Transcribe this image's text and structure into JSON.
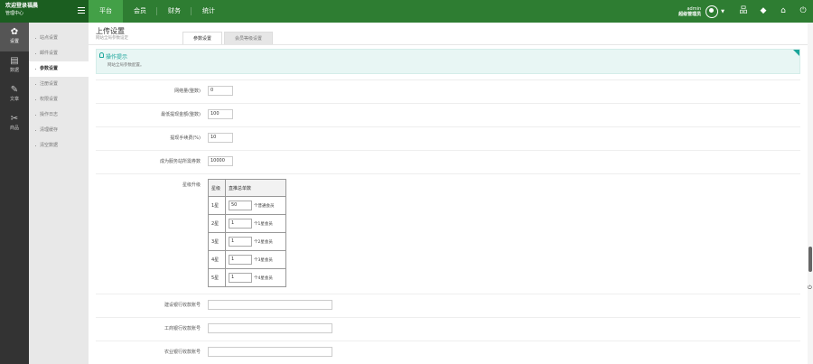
{
  "brand": {
    "line1": "欢迎登录福晨",
    "line2": "管理中心"
  },
  "nav": {
    "tabs": [
      "平台",
      "会员",
      "财务",
      "统计"
    ]
  },
  "user": {
    "name": "admin",
    "role": "超级管理员"
  },
  "sidebar": {
    "items": [
      {
        "icon": "✿",
        "label": "设置"
      },
      {
        "icon": "▤",
        "label": "数据"
      },
      {
        "icon": "✎",
        "label": "文章"
      },
      {
        "icon": "✂",
        "label": "商品"
      }
    ]
  },
  "submenu": {
    "items": [
      "站点设置",
      "邮件设置",
      "参数设置",
      "注册设置",
      "权限设置",
      "操作日志",
      "清理缓存",
      "清空数据"
    ]
  },
  "page": {
    "title": "上传设置",
    "subtitle": "网站全局参数设定"
  },
  "tabs": [
    "参数设置",
    "会员等级设置"
  ],
  "tips": {
    "title": "操作提示",
    "desc": "网站全局参数配置。"
  },
  "form": {
    "fields": [
      {
        "label": "网络量(整数)",
        "value": "0"
      },
      {
        "label": "最低提现金额(整数)",
        "value": "100"
      },
      {
        "label": "提现手续费(%)",
        "value": "10"
      },
      {
        "label": "成为服务站所需券数",
        "value": "10000"
      }
    ],
    "level_label": "星级升级",
    "level_table": {
      "headers": [
        "星级",
        "直推总单数"
      ],
      "rows": [
        {
          "level": "1星",
          "value": "50",
          "suffix": "个普通会员"
        },
        {
          "level": "2星",
          "value": "1",
          "suffix": "个1星会员"
        },
        {
          "level": "3星",
          "value": "1",
          "suffix": "个2星会员"
        },
        {
          "level": "4星",
          "value": "1",
          "suffix": "个3星会员"
        },
        {
          "level": "5星",
          "value": "1",
          "suffix": "个4星会员"
        }
      ]
    },
    "bank_fields": [
      {
        "label": "建设银行收款账号",
        "value": ""
      },
      {
        "label": "工商银行收款账号",
        "value": ""
      },
      {
        "label": "农业银行收款账号",
        "value": ""
      }
    ]
  }
}
